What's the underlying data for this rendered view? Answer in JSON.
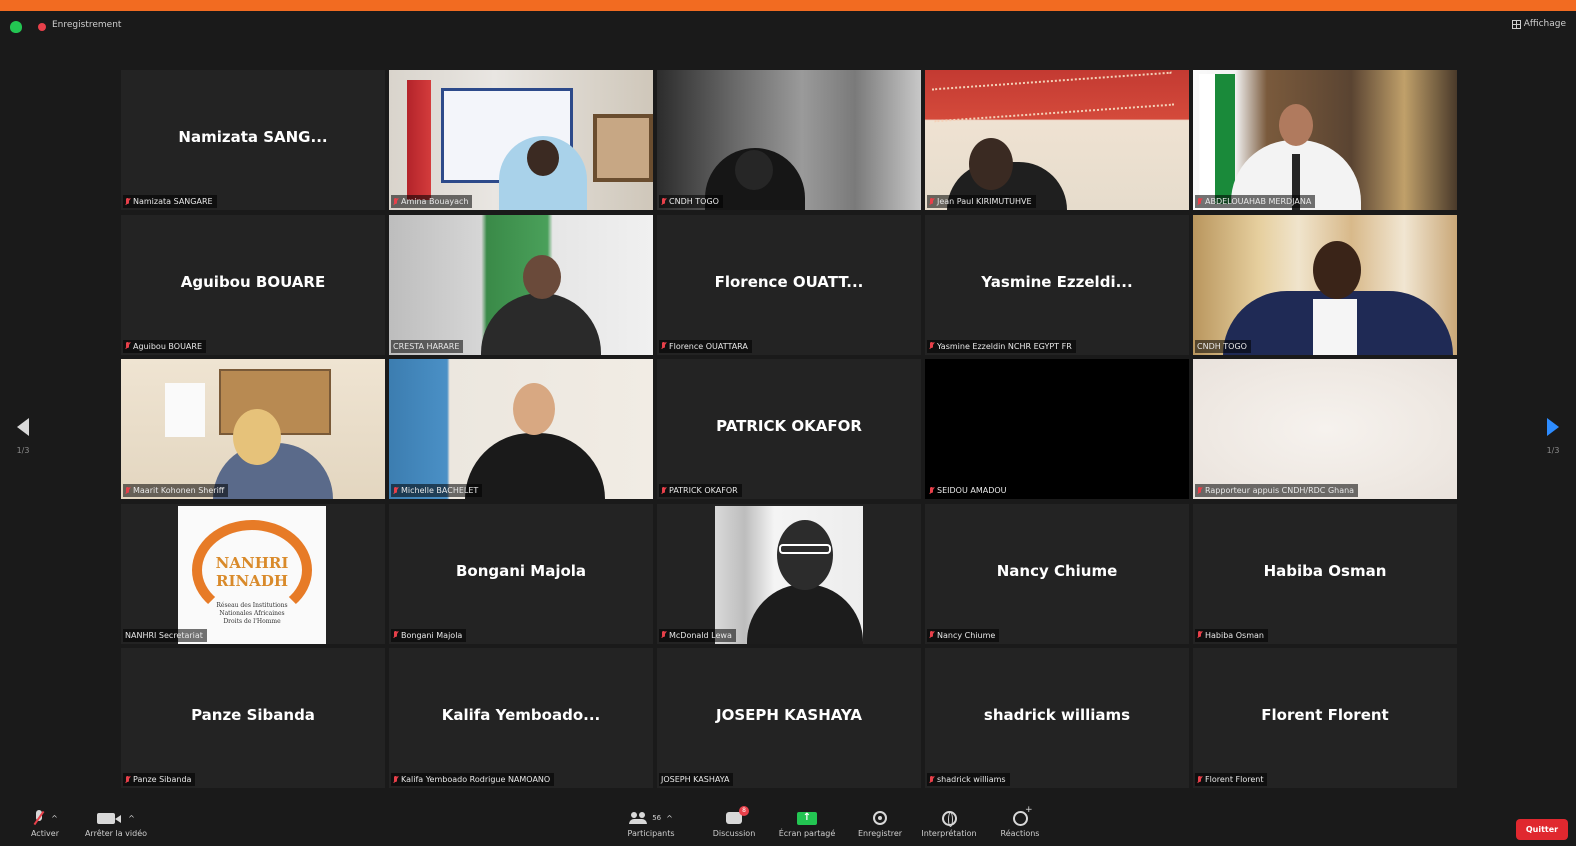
{
  "topbar": {
    "recording_label": "Enregistrement",
    "view_label": "Affichage"
  },
  "pager": {
    "left_indicator": "1/3",
    "right_indicator": "1/3"
  },
  "tiles": [
    {
      "display": "Namizata  SANG...",
      "label": "Namizata SANGARE",
      "muted": true
    },
    {
      "display": "",
      "label": "Amina Bouayach",
      "muted": true,
      "video": "office"
    },
    {
      "display": "",
      "label": "CNDH TOGO",
      "muted": true,
      "video": "blur"
    },
    {
      "display": "",
      "label": "Jean Paul KIRIMUTUHVE",
      "muted": true,
      "video": "banner"
    },
    {
      "display": "",
      "label": "ABDELOUAHAB MERDJANA",
      "muted": true,
      "video": "algeria"
    },
    {
      "display": "Aguibou BOUARE",
      "label": "Aguibou BOUARE",
      "muted": true
    },
    {
      "display": "",
      "label": "CRESTA HARARE",
      "muted": false,
      "video": "green"
    },
    {
      "display": "Florence  OUATT...",
      "label": "Florence OUATTARA",
      "muted": true
    },
    {
      "display": "Yasmine  Ezzeldi...",
      "label": "Yasmine Ezzeldin NCHR EGYPT FR",
      "muted": true
    },
    {
      "display": "",
      "label": "CNDH TOGO",
      "muted": false,
      "video": "curtain",
      "active": true
    },
    {
      "display": "",
      "label": "Maarit Kohonen Sheriff",
      "muted": true,
      "video": "room"
    },
    {
      "display": "",
      "label": "Michelle BACHELET",
      "muted": true,
      "video": "un"
    },
    {
      "display": "PATRICK OKAFOR",
      "label": "PATRICK OKAFOR",
      "muted": true
    },
    {
      "display": "",
      "label": "SEIDOU AMADOU",
      "muted": true,
      "video": "black"
    },
    {
      "display": "",
      "label": "Rapporteur appuis CNDH/RDC Ghana",
      "muted": true,
      "video": "white"
    },
    {
      "display": "",
      "label": "NANHRI Secretariat",
      "muted": false,
      "video": "logo"
    },
    {
      "display": "Bongani Majola",
      "label": "Bongani Majola",
      "muted": true
    },
    {
      "display": "",
      "label": "McDonald Lewa",
      "muted": true,
      "video": "bw"
    },
    {
      "display": "Nancy Chiume",
      "label": "Nancy Chiume",
      "muted": true
    },
    {
      "display": "Habiba Osman",
      "label": "Habiba Osman",
      "muted": true
    },
    {
      "display": "Panze Sibanda",
      "label": "Panze Sibanda",
      "muted": true
    },
    {
      "display": "Kalifa  Yemboado...",
      "label": "Kalifa Yemboado Rodrigue NAMOANO",
      "muted": true
    },
    {
      "display": "JOSEPH KASHAYA",
      "label": "JOSEPH KASHAYA",
      "muted": false
    },
    {
      "display": "shadrick williams",
      "label": "shadrick williams",
      "muted": true
    },
    {
      "display": "Florent Florent",
      "label": "Florent Florent",
      "muted": true
    }
  ],
  "logo": {
    "line1": "NANHRI",
    "line2": "RINADH",
    "sub1": "Réseau des Institutions",
    "sub2": "Nationales Africaines",
    "sub3": "Droits de l'Homme"
  },
  "toolbar": {
    "unmute_label": "Activer",
    "video_label": "Arrêter la vidéo",
    "participants_label": "Participants",
    "participants_count": "56",
    "chat_label": "Discussion",
    "chat_badge": "8",
    "share_label": "Écran partagé",
    "record_label": "Enregistrer",
    "interpretation_label": "Interprétation",
    "reactions_label": "Réactions",
    "quit_label": "Quitter"
  },
  "colors": {
    "accent": "#f26b21",
    "share_green": "#23c552",
    "quit_red": "#e0282f",
    "active_speaker": "#c8e35a",
    "nav_blue": "#2d8cff"
  }
}
